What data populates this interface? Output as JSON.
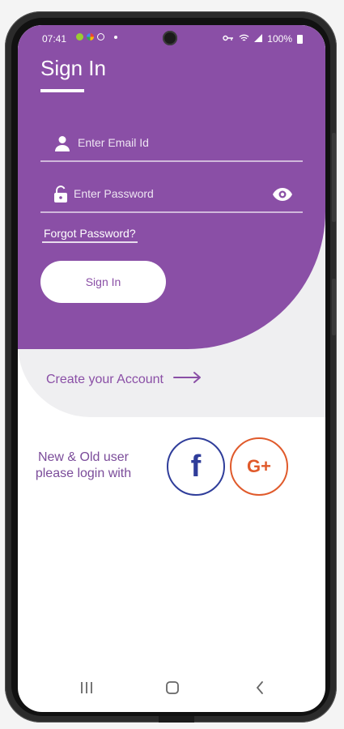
{
  "status_bar": {
    "time": "07:41",
    "battery": "100%"
  },
  "signin": {
    "title": "Sign In",
    "email_placeholder": "Enter Email Id",
    "password_placeholder": "Enter Password",
    "forgot_label": "Forgot Password?",
    "button_label": "Sign In"
  },
  "create_account": {
    "label": "Create your Account"
  },
  "social": {
    "prompt_line1": "New & Old user",
    "prompt_line2": "please login with",
    "facebook_label": "f",
    "google_label": "G+"
  },
  "icons": {
    "email": "user-icon",
    "password": "lock-icon",
    "visibility": "eye-icon",
    "arrow": "arrow-right-icon"
  },
  "colors": {
    "primary": "#8a4fa6",
    "facebook": "#2f3d9a",
    "google": "#e05a2b"
  }
}
